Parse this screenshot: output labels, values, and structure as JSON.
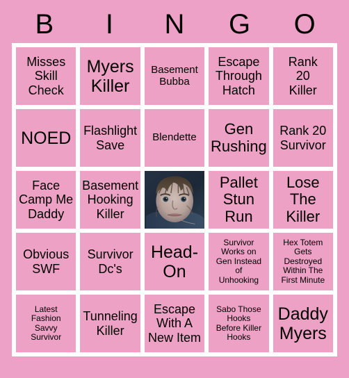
{
  "card": {
    "title": "BINGO",
    "header_letters": [
      "B",
      "I",
      "N",
      "G",
      "O"
    ],
    "background_color": "#eea1c6",
    "grid_line_color": "#ffffff",
    "cell_color": "#eda1c5",
    "text_color": "#000000",
    "rows": 5,
    "columns": 5
  },
  "cells": [
    {
      "id": "b1",
      "text": "Misses\nSkill\nCheck",
      "size": "fs-md",
      "type": "text"
    },
    {
      "id": "i1",
      "text": "Myers\nKiller",
      "size": "fs-xl",
      "type": "text"
    },
    {
      "id": "n1",
      "text": "Basement\nBubba",
      "size": "fs-sm",
      "type": "text"
    },
    {
      "id": "g1",
      "text": "Escape\nThrough\nHatch",
      "size": "fs-md",
      "type": "text"
    },
    {
      "id": "o1",
      "text": "Rank\n20\nKiller",
      "size": "fs-md",
      "type": "text"
    },
    {
      "id": "b2",
      "text": "NOED",
      "size": "fs-xl",
      "type": "text"
    },
    {
      "id": "i2",
      "text": "Flashlight\nSave",
      "size": "fs-md",
      "type": "text"
    },
    {
      "id": "n2",
      "text": "Blendette",
      "size": "fs-sm",
      "type": "text"
    },
    {
      "id": "g2",
      "text": "Gen\nRushing",
      "size": "fs-lg",
      "type": "text"
    },
    {
      "id": "o2",
      "text": "Rank 20\nSurvivor",
      "size": "fs-md",
      "type": "text"
    },
    {
      "id": "b3",
      "text": "Face\nCamp Me\nDaddy",
      "size": "fs-md",
      "type": "text"
    },
    {
      "id": "i3",
      "text": "Basement\nHooking\nKiller",
      "size": "fs-md",
      "type": "text"
    },
    {
      "id": "n3",
      "text": "",
      "size": "fs-md",
      "type": "image",
      "image_name": "michael-myers-face-photo"
    },
    {
      "id": "g3",
      "text": "Pallet\nStun\nRun",
      "size": "fs-lg",
      "type": "text"
    },
    {
      "id": "o3",
      "text": "Lose\nThe\nKiller",
      "size": "fs-lg",
      "type": "text"
    },
    {
      "id": "b4",
      "text": "Obvious\nSWF",
      "size": "fs-md",
      "type": "text"
    },
    {
      "id": "i4",
      "text": "Survivor\nDc's",
      "size": "fs-md",
      "type": "text"
    },
    {
      "id": "n4",
      "text": "Head-\nOn",
      "size": "fs-xl",
      "type": "text"
    },
    {
      "id": "g4",
      "text": "Survivor\nWorks on\nGen Instead\nof\nUnhooking",
      "size": "fs-xs",
      "type": "text"
    },
    {
      "id": "o4",
      "text": "Hex Totem\nGets\nDestroyed\nWithin The\nFirst Minute",
      "size": "fs-xs",
      "type": "text"
    },
    {
      "id": "b5",
      "text": "Latest\nFashion\nSavvy\nSurvivor",
      "size": "fs-xs",
      "type": "text"
    },
    {
      "id": "i5",
      "text": "Tunneling\nKiller",
      "size": "fs-md",
      "type": "text"
    },
    {
      "id": "n5",
      "text": "Escape\nWith A\nNew Item",
      "size": "fs-md",
      "type": "text"
    },
    {
      "id": "g5",
      "text": "Sabo Those\nHooks\nBefore Killer\nHooks",
      "size": "fs-xs",
      "type": "text"
    },
    {
      "id": "o5",
      "text": "Daddy\nMyers",
      "size": "fs-xl",
      "type": "text"
    }
  ]
}
